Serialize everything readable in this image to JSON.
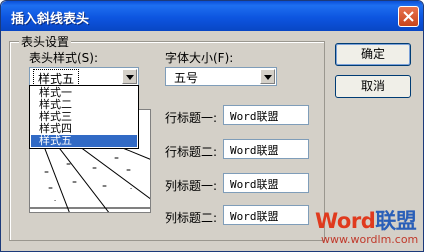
{
  "window": {
    "title": "插入斜线表头"
  },
  "group": {
    "legend": "表头设置"
  },
  "style_select": {
    "label": "表头样式(S):",
    "value": "样式五",
    "options": [
      "样式一",
      "样式二",
      "样式三",
      "样式四",
      "样式五"
    ],
    "selected_index": 4
  },
  "font_select": {
    "label": "字体大小(F):",
    "value": "五号"
  },
  "fields": [
    {
      "label": "行标题一:",
      "value": "Word联盟"
    },
    {
      "label": "行标题二:",
      "value": "Word联盟"
    },
    {
      "label": "列标题一:",
      "value": "Word联盟"
    },
    {
      "label": "列标题二:",
      "value": "Word联盟"
    }
  ],
  "buttons": {
    "ok": "确定",
    "cancel": "取消"
  },
  "watermark": {
    "brand_word": "Word",
    "brand_lm": "联盟",
    "url": "www.wordlm.com"
  },
  "colors": {
    "titlebar": "#0a50d8",
    "selection": "#316ac5",
    "watermark_red": "#e03a1e",
    "watermark_blue": "#2a5fb8"
  },
  "icons": {
    "close": "close-icon",
    "dropdown": "chevron-down-icon"
  }
}
